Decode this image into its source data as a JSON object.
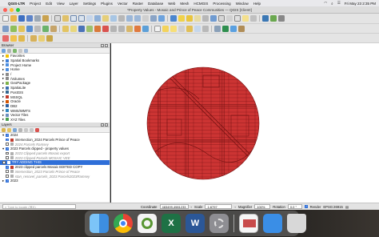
{
  "menubar": {
    "apple": "",
    "app_name": "QGIS-LTR",
    "items": [
      "Project",
      "Edit",
      "View",
      "Layer",
      "Settings",
      "Plugins",
      "Vector",
      "Raster",
      "Database",
      "Web",
      "Mesh",
      "HCMGIS",
      "Processing",
      "Window",
      "Help"
    ],
    "clock": "Fri May 23 2:35 PM"
  },
  "window": {
    "title": "*Property Values - Mosaic and Prince of Peace Communities — QGIS [Client!]"
  },
  "browser_panel": {
    "title": "Browser",
    "items": [
      {
        "label": "Favorites",
        "icon": "star-icon",
        "color": "#f2c200"
      },
      {
        "label": "Spatial Bookmarks",
        "icon": "bookmark-icon",
        "color": "#3b7dd8"
      },
      {
        "label": "Project Home",
        "icon": "folder-icon",
        "color": "#4d8fe0"
      },
      {
        "label": "Home",
        "icon": "folder-icon",
        "color": "#4d8fe0"
      },
      {
        "label": "/",
        "icon": "drive-icon",
        "color": "#8a8a8a"
      },
      {
        "label": "/Volumes",
        "icon": "drive-icon",
        "color": "#8a8a8a"
      },
      {
        "label": "GeoPackage",
        "icon": "geopackage-icon",
        "color": "#7fb34a"
      },
      {
        "label": "SpatiaLite",
        "icon": "spatialite-icon",
        "color": "#3a6fb0"
      },
      {
        "label": "PostGIS",
        "icon": "postgis-icon",
        "color": "#336791"
      },
      {
        "label": "MSSQL",
        "icon": "mssql-icon",
        "color": "#c0392b"
      },
      {
        "label": "Oracle",
        "icon": "oracle-icon",
        "color": "#d35400"
      },
      {
        "label": "DB2",
        "icon": "db2-icon",
        "color": "#2d5e9e"
      },
      {
        "label": "WMS/WMTS",
        "icon": "wms-icon",
        "color": "#2e86c1"
      },
      {
        "label": "Vector Tiles",
        "icon": "vector-tiles-icon",
        "color": "#6c8ebf"
      },
      {
        "label": "XYZ Tiles",
        "icon": "xyz-tiles-icon",
        "color": "#48a14d"
      }
    ]
  },
  "layers_panel": {
    "title": "Layers",
    "items": [
      {
        "label": "2024",
        "type": "group",
        "checked": true
      },
      {
        "label": "intersection_2024 Parcels Prince of Peace",
        "type": "layer",
        "checked": true,
        "color": "#c0392b"
      },
      {
        "label": "2024 Parcels Ramsey",
        "type": "layer",
        "checked": false,
        "color": "#b0b0b0"
      },
      {
        "label": "2023 Parcels clipped - property values",
        "type": "group",
        "checked": true
      },
      {
        "label": "2023 Clipped parcels Mosaic export",
        "type": "layer",
        "checked": false,
        "color": "#b0b0b0"
      },
      {
        "label": "2023 Clipped Parcels MOSAIC VEE",
        "type": "layer",
        "checked": false,
        "color": "#b0b0b0"
      },
      {
        "label": "TRY ADDING THIS",
        "type": "layer",
        "checked": false,
        "selected": true,
        "color": "#ffffff"
      },
      {
        "label": "2023 clipped parcels Mosaic EDITED COPY",
        "type": "layer",
        "checked": true,
        "color": "#c0392b"
      },
      {
        "label": "intersection_2023 Parcels Prince of Peace",
        "type": "layer",
        "checked": false,
        "color": "#b0b0b0"
      },
      {
        "label": "stan_resovel_parcels_2023 Parcels2023Ramsey",
        "type": "layer",
        "checked": false,
        "color": "#b0b0b0"
      },
      {
        "label": "2023",
        "type": "group",
        "checked": true
      }
    ]
  },
  "map": {
    "fill_color": "#cc3433",
    "edge_color": "#7a1414"
  },
  "statusbar": {
    "locator_placeholder": "Type to locate (⌘K)",
    "coordinate_label": "Coordinate",
    "coordinate_value": "483499,4981233",
    "scale_label": "Scale",
    "scale_value": "1:6797",
    "magnifier_label": "Magnifier",
    "magnifier_value": "100%",
    "rotation_label": "Rotation",
    "rotation_value": "0.0 °",
    "render_label": "Render",
    "crs_value": "EPSG:26915"
  },
  "dock": {
    "apps": [
      {
        "name": "finder-icon",
        "color": "#4aa3f0"
      },
      {
        "name": "chrome-icon",
        "color": "#f2f2f2"
      },
      {
        "name": "qgis-icon",
        "color": "#589632"
      },
      {
        "name": "excel-icon",
        "color": "#1e7145"
      },
      {
        "name": "word-icon",
        "color": "#2b5797"
      },
      {
        "name": "settings-icon",
        "color": "#8e8e93"
      },
      {
        "name": "preview-icon",
        "color": "#f5f5f5"
      },
      {
        "name": "folder-icon",
        "color": "#3a8ee6"
      },
      {
        "name": "trash-icon",
        "color": "#d8d8d8"
      }
    ]
  }
}
